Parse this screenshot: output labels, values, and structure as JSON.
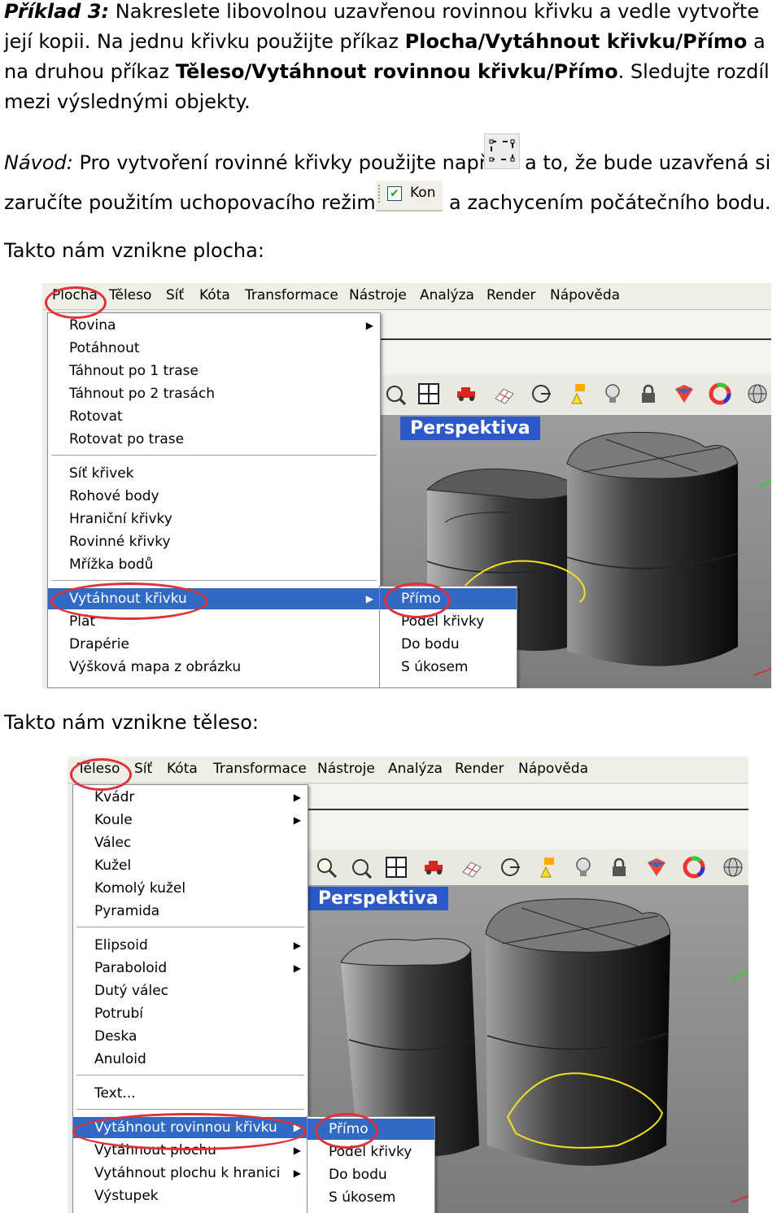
{
  "intro": {
    "label": "Příklad 3:",
    "t1": " Nakreslete libovolnou uzavřenou rovinnou křivku a vedle vytvořte její kopii. Na jednu křivku použijte příkaz ",
    "cmd1": "Plocha/Vytáhnout křivku/Přímo",
    "t2": " a na druhou příkaz ",
    "cmd2": "Těleso/Vytáhnout rovinnou křivku/Přímo",
    "t3": ". Sledujte rozdíl mezi výslednými objekty."
  },
  "guide": {
    "label": "Návod:",
    "t1": " Pro vytvoření rovinné křivky použijte např.",
    "t2": "a to, že bude uzavřená si",
    "t3": "zaručíte použitím uchopovacího režimu",
    "snap_label": "Kon",
    "t4": "a zachycením počátečního bodu."
  },
  "caption_surface": "Takto nám vznikne plocha:",
  "caption_solid": "Takto nám vznikne těleso:",
  "shot1": {
    "menubar": [
      "Plocha",
      "Těleso",
      "Síť",
      "Kóta",
      "Transformace",
      "Nástroje",
      "Analýza",
      "Render",
      "Nápověda"
    ],
    "viewport_label": "Perspektiva",
    "menu_group1": [
      "Rovina",
      "Potáhnout",
      "Táhnout po 1 trase",
      "Táhnout po 2 trasách",
      "Rotovat",
      "Rotovat po trase"
    ],
    "menu_group2": [
      "Síť křivek",
      "Rohové body",
      "Hraniční křivky",
      "Rovinné křivky",
      "Mřížka bodů"
    ],
    "menu_group3": [
      "Vytáhnout křivku",
      "Plát",
      "Drapérie",
      "Výšková mapa z obrázku"
    ],
    "submenu": [
      "Přímo",
      "Podél křivky",
      "Do bodu",
      "S úkosem"
    ]
  },
  "shot2": {
    "menubar": [
      "Těleso",
      "Síť",
      "Kóta",
      "Transformace",
      "Nástroje",
      "Analýza",
      "Render",
      "Nápověda"
    ],
    "viewport_label": "Perspektiva",
    "menu_group1": [
      "Kvádr",
      "Koule",
      "Válec",
      "Kužel",
      "Komolý kužel",
      "Pyramida"
    ],
    "menu_group2": [
      "Elipsoid",
      "Paraboloid",
      "Dutý válec",
      "Potrubí",
      "Deska",
      "Anuloid"
    ],
    "menu_group3": [
      "Text..."
    ],
    "menu_group4": [
      "Vytáhnout rovinnou křivku",
      "Vytáhnout plochu",
      "Vytáhnout plochu k hranici",
      "Výstupek"
    ],
    "submenu": [
      "Přímo",
      "Podél křivky",
      "Do bodu",
      "S úkosem"
    ]
  },
  "colors": {
    "highlight": "#316ac5",
    "circle": "#e0303a",
    "viewport_title": "#2c58c8",
    "curve": "#f0e020"
  }
}
